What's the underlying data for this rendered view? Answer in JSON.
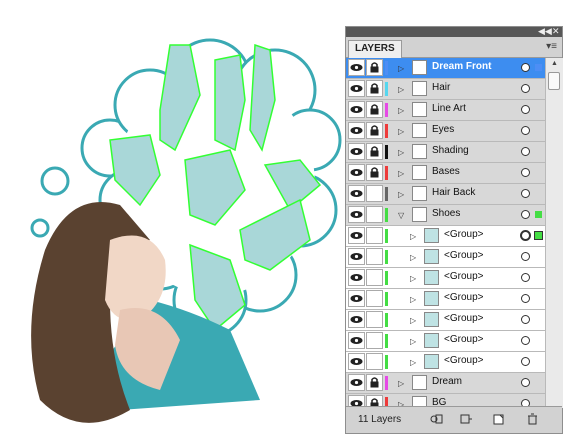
{
  "panel": {
    "title": "LAYERS",
    "footer_count": "11 Layers",
    "collapse_icon": "double-arrow-icon",
    "menu_icon": "panel-menu-icon"
  },
  "layers": [
    {
      "name": "Dream Front",
      "type": "layer",
      "color": "#4d8ef5",
      "locked": true,
      "selected": true,
      "expand": "right"
    },
    {
      "name": "Hair",
      "type": "layer",
      "color": "#56d7ef",
      "locked": true,
      "expand": "right"
    },
    {
      "name": "Line Art",
      "type": "layer",
      "color": "#e64ae6",
      "locked": true,
      "expand": "right"
    },
    {
      "name": "Eyes",
      "type": "layer",
      "color": "#ee3b3b",
      "locked": true,
      "expand": "right"
    },
    {
      "name": "Shading",
      "type": "layer",
      "color": "#111111",
      "locked": true,
      "expand": "right"
    },
    {
      "name": "Bases",
      "type": "layer",
      "color": "#ee3b3b",
      "locked": true,
      "expand": "right"
    },
    {
      "name": "Hair Back",
      "type": "layer",
      "color": "#666666",
      "locked": false,
      "expand": "right"
    },
    {
      "name": "Shoes",
      "type": "layer",
      "color": "#44dd44",
      "locked": false,
      "expand": "down"
    },
    {
      "name": "<Group>",
      "type": "group",
      "color": "#44dd44",
      "locked": false,
      "expand": "right"
    },
    {
      "name": "<Group>",
      "type": "group",
      "color": "#44dd44",
      "locked": false,
      "expand": "right"
    },
    {
      "name": "<Group>",
      "type": "group",
      "color": "#44dd44",
      "locked": false,
      "expand": "right"
    },
    {
      "name": "<Group>",
      "type": "group",
      "color": "#44dd44",
      "locked": false,
      "expand": "right"
    },
    {
      "name": "<Group>",
      "type": "group",
      "color": "#44dd44",
      "locked": false,
      "expand": "right"
    },
    {
      "name": "<Group>",
      "type": "group",
      "color": "#44dd44",
      "locked": false,
      "expand": "right"
    },
    {
      "name": "<Group>",
      "type": "group",
      "color": "#44dd44",
      "locked": false,
      "expand": "right"
    },
    {
      "name": "Dream",
      "type": "layer",
      "color": "#e64ae6",
      "locked": true,
      "expand": "right"
    },
    {
      "name": "BG",
      "type": "layer",
      "color": "#ee3b3b",
      "locked": true,
      "expand": "right"
    }
  ],
  "footer_buttons": [
    "make-clipping-mask-icon",
    "new-sublayer-icon",
    "new-layer-icon",
    "delete-layer-icon"
  ],
  "colors": {
    "accent": "#3d8df0",
    "dream_fill": "#a9d7d8",
    "dream_stroke": "#3aa9b3",
    "selection": "#33ff33"
  }
}
